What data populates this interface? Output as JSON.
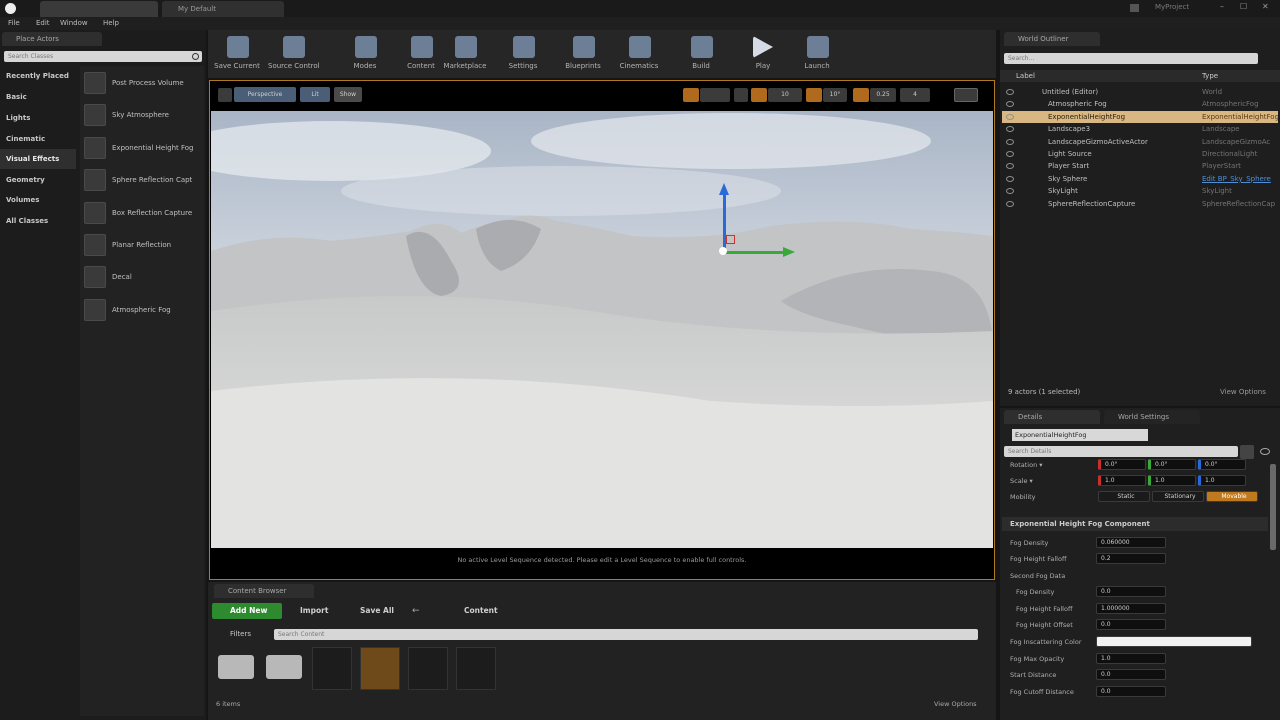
{
  "titlebar": {
    "tabs": [
      "",
      "My Default"
    ],
    "project": "MyProject",
    "window_controls": [
      "–",
      "☐",
      "✕"
    ]
  },
  "menu": [
    "File",
    "Edit",
    "Window",
    "Help"
  ],
  "modes": {
    "tab": "Place Actors",
    "search_placeholder": "Search Classes",
    "categories": [
      "Recently Placed",
      "Basic",
      "Lights",
      "Cinematic",
      "Visual Effects",
      "Geometry",
      "Volumes",
      "All Classes"
    ],
    "selected_category": "Visual Effects",
    "items": [
      {
        "label": "Post Process Volume",
        "icon": "post-process-volume-icon"
      },
      {
        "label": "Sky Atmosphere",
        "icon": "sky-atmosphere-icon"
      },
      {
        "label": "Exponential Height Fog",
        "icon": "height-fog-icon"
      },
      {
        "label": "Sphere Reflection Capt",
        "icon": "sphere-reflection-icon"
      },
      {
        "label": "Box Reflection Capture",
        "icon": "box-reflection-icon"
      },
      {
        "label": "Planar Reflection",
        "icon": "planar-reflection-icon"
      },
      {
        "label": "Decal",
        "icon": "decal-icon"
      },
      {
        "label": "Atmospheric Fog",
        "icon": "atmospheric-fog-icon"
      }
    ]
  },
  "toolbar": {
    "items": [
      {
        "label": "Save Current",
        "icon": "save-icon"
      },
      {
        "label": "Source Control",
        "icon": "source-control-icon"
      },
      {
        "label": "Modes",
        "icon": "modes-icon"
      },
      {
        "label": "Content",
        "icon": "content-icon"
      },
      {
        "label": "Marketplace",
        "icon": "marketplace-icon"
      },
      {
        "label": "Settings",
        "icon": "settings-icon"
      },
      {
        "label": "Blueprints",
        "icon": "blueprints-icon"
      },
      {
        "label": "Cinematics",
        "icon": "cinematics-icon"
      },
      {
        "label": "Build",
        "icon": "build-icon"
      },
      {
        "label": "Play",
        "icon": "play-icon"
      },
      {
        "label": "Launch",
        "icon": "launch-icon"
      }
    ]
  },
  "viewport": {
    "perspective": "Perspective",
    "lit": "Lit",
    "show": "Show",
    "snap_values": [
      "10",
      "10°",
      "0.25"
    ],
    "camera_speed": "4",
    "message": "No active Level Sequence detected. Please edit a Level Sequence to enable full controls.",
    "colors": {
      "sky": "#b8c3d2",
      "ground": "#d8d8d6",
      "accent": "#f0a020"
    }
  },
  "content_browser": {
    "tab": "Content Browser",
    "add_new": "Add New",
    "import": "Import",
    "save_all": "Save All",
    "path": "Content",
    "filters": "Filters",
    "search_placeholder": "Search Content",
    "items_count": "6 items",
    "view_options": "View Options",
    "assets": [
      "",
      "",
      "",
      "",
      "",
      ""
    ]
  },
  "outliner": {
    "tab": "World Outliner",
    "search_placeholder": "Search...",
    "col_label": "Label",
    "col_type": "Type",
    "rows": [
      {
        "name": "Untitled (Editor)",
        "type": "World",
        "indent": 0
      },
      {
        "name": "Atmospheric Fog",
        "type": "AtmosphericFog",
        "indent": 1
      },
      {
        "name": "ExponentialHeightFog",
        "type": "ExponentialHeightFog",
        "indent": 1,
        "selected": true
      },
      {
        "name": "Landscape3",
        "type": "Landscape",
        "indent": 1
      },
      {
        "name": "LandscapeGizmoActiveActor",
        "type": "LandscapeGizmoAc",
        "indent": 1
      },
      {
        "name": "Light Source",
        "type": "DirectionalLight",
        "indent": 1
      },
      {
        "name": "Player Start",
        "type": "PlayerStart",
        "indent": 1
      },
      {
        "name": "Sky Sphere",
        "type": "Edit BP_Sky_Sphere",
        "indent": 1
      },
      {
        "name": "SkyLight",
        "type": "SkyLight",
        "indent": 1
      },
      {
        "name": "SphereReflectionCapture",
        "type": "SphereReflectionCap",
        "indent": 1
      }
    ],
    "footer": "9 actors (1 selected)",
    "view_options": "View Options"
  },
  "details": {
    "tabs": [
      "Details",
      "World Settings"
    ],
    "name_field": "ExponentialHeightFog",
    "search_placeholder": "Search Details",
    "rotation": {
      "label": "Rotation ▾",
      "x": "0.0°",
      "y": "0.0°",
      "z": "0.0°"
    },
    "scale": {
      "label": "Scale ▾",
      "x": "1.0",
      "y": "1.0",
      "z": "1.0"
    },
    "mobility": {
      "label": "Mobility",
      "options": [
        "Static",
        "Stationary",
        "Movable"
      ],
      "selected": "Movable"
    },
    "section": "Exponential Height Fog Component",
    "fog_density": {
      "label": "Fog Density",
      "value": "0.060000"
    },
    "fog_height_falloff": {
      "label": "Fog Height Falloff",
      "value": "0.2"
    },
    "second_fog_data": "Second Fog Data",
    "fog_density_2": {
      "label": "Fog Density",
      "value": "0.0"
    },
    "fog_height_falloff_2": {
      "label": "Fog Height Falloff",
      "value": "1.000000"
    },
    "fog_height_offset": {
      "label": "Fog Height Offset",
      "value": "0.0"
    },
    "fog_inscattering_color": "Fog Inscattering Color",
    "fog_max_opacity": {
      "label": "Fog Max Opacity",
      "value": "1.0"
    },
    "start_distance": {
      "label": "Start Distance",
      "value": "0.0"
    },
    "fog_cutoff_distance": {
      "label": "Fog Cutoff Distance",
      "value": "0.0"
    }
  }
}
